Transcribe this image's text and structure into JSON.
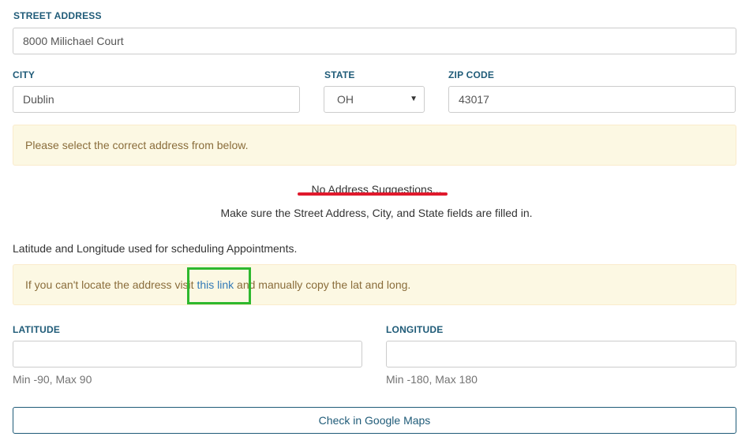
{
  "street": {
    "label": "STREET ADDRESS",
    "value": "8000 Milichael Court"
  },
  "city": {
    "label": "CITY",
    "value": "Dublin"
  },
  "state": {
    "label": "STATE",
    "value": "OH",
    "caret_icon": "caret-down-icon"
  },
  "zip": {
    "label": "ZIP CODE",
    "value": "43017"
  },
  "alert_select": {
    "text": "Please select the correct address from below."
  },
  "suggestions": {
    "none_text": "No Address Suggestions...",
    "hint_text": "Make sure the Street Address, City, and State fields are filled in."
  },
  "latlong_note": "Latitude and Longitude used for scheduling Appointments.",
  "alert_locate": {
    "before": "If you can't locate the address visit ",
    "link": "this link",
    "after": " and manually copy the lat and long."
  },
  "latitude": {
    "label": "LATITUDE",
    "value": "",
    "help": "Min -90, Max 90"
  },
  "longitude": {
    "label": "LONGITUDE",
    "value": "",
    "help": "Min -180, Max 180"
  },
  "maps_button": {
    "label": "Check in Google Maps"
  },
  "colors": {
    "label": "#1f5b78",
    "alert_bg": "#fcf8e3",
    "alert_text": "#8a6d3b",
    "link": "#337ab7",
    "annotation_red": "#e0192c",
    "annotation_green": "#2eb82e"
  }
}
